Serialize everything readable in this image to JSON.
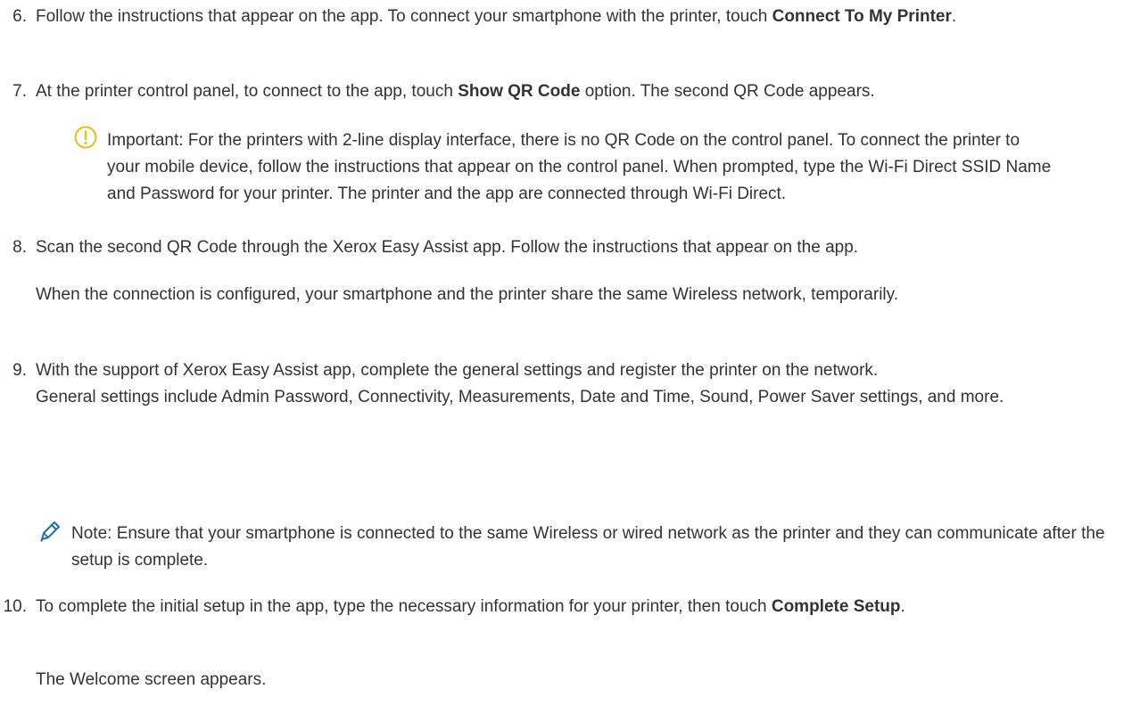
{
  "step6": {
    "number": "6.",
    "text_a": "Follow the instructions that appear on the app. To connect your smartphone with the printer, touch ",
    "bold": "Connect To My Printer",
    "text_b": "."
  },
  "step7": {
    "number": "7.",
    "text_a": "At the printer control panel, to connect to the app, touch ",
    "bold": "Show QR Code",
    "text_b": " option. The second QR Code appears."
  },
  "important": {
    "icon": "info-circle-icon",
    "text": "Important: For the printers with 2-line display interface, there is no QR Code on the control panel. To connect the printer to your mobile device, follow the instructions that appear on the control panel. When prompted, type the Wi-Fi Direct SSID Name and Password for your printer. The printer and the app are connected through Wi-Fi Direct."
  },
  "step8": {
    "number": "8.",
    "text": "Scan the second QR Code through the Xerox Easy Assist app. Follow the instructions that appear on the app.",
    "para": "When the connection is configured, your smartphone and the printer share the same Wireless network, temporarily."
  },
  "step9": {
    "number": "9.",
    "text": "With the support of Xerox Easy Assist app, complete the general settings and register the printer on the network.",
    "text2": "General settings include Admin Password, Connectivity, Measurements, Date and Time, Sound, Power Saver settings, and more."
  },
  "note": {
    "icon": "pencil-icon",
    "text": "Note: Ensure that your smartphone is connected to the same Wireless or wired network as the printer and they can communicate after the setup is complete."
  },
  "step10": {
    "number": "10.",
    "text_a": "To complete the initial setup in the app, type the necessary information for your printer, then touch ",
    "bold": "Complete Setup",
    "text_b": ".",
    "para": "The Welcome screen appears."
  },
  "colors": {
    "text": "#333333",
    "icon_yellow": "#e0c21a",
    "icon_blue": "#1a6fb8"
  }
}
